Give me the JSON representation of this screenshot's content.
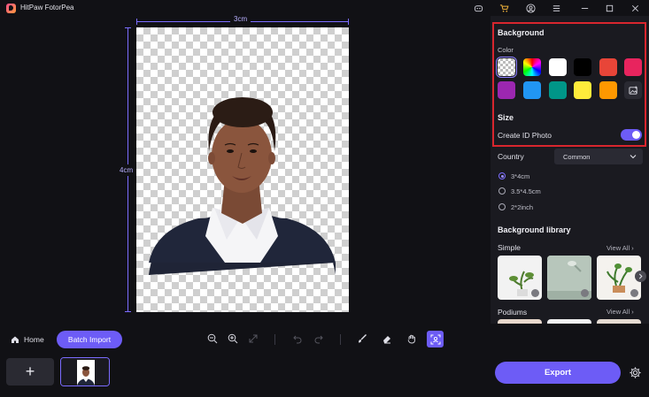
{
  "window": {
    "app_title": "HitPaw FotorPea",
    "icons": [
      "discord-icon",
      "cart-icon",
      "account-icon",
      "menu-icon",
      "minimize-icon",
      "maximize-icon",
      "close-icon"
    ]
  },
  "canvas": {
    "width_label": "3cm",
    "height_label": "4cm"
  },
  "panel": {
    "background_title": "Background",
    "color_label": "Color",
    "swatches": [
      "transparent",
      "#gradient",
      "#ffffff",
      "#000000",
      "#e84538",
      "#e8245e",
      "#9c27b0",
      "#2196f3",
      "#009688",
      "#ffeb3b",
      "#ff9800",
      "custom-image"
    ],
    "size_title": "Size",
    "create_id_label": "Create ID Photo",
    "create_id_enabled": true,
    "country_label": "Country",
    "country_value": "Common",
    "sizes": [
      {
        "label": "3*4cm",
        "selected": true
      },
      {
        "label": "3.5*4.5cm",
        "selected": false
      },
      {
        "label": "2*2inch",
        "selected": false
      }
    ],
    "library_title": "Background library",
    "simple_label": "Simple",
    "simple_view_all": "View All",
    "podiums_label": "Podiums",
    "podiums_view_all": "View All"
  },
  "bottom": {
    "home_label": "Home",
    "batch_label": "Batch Import",
    "add_label": "+",
    "export_label": "Export"
  },
  "colors": {
    "accent": "#6d5cf6",
    "highlight_border": "#d8262e",
    "background": "#111115",
    "panel": "#1a1a20"
  }
}
